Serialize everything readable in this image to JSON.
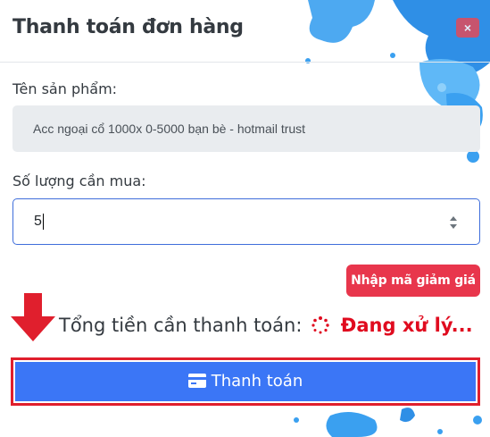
{
  "modal": {
    "title": "Thanh toán đơn hàng",
    "close_label": "×"
  },
  "product": {
    "label": "Tên sản phẩm:",
    "value": "Acc ngoại cổ 1000x 0-5000 bạn bè - hotmail trust"
  },
  "quantity": {
    "label": "Số lượng cần mua:",
    "value": "5"
  },
  "discount_button": "Nhập mã giảm giá",
  "total": {
    "label": "Tổng tiền cần thanh toán:",
    "status": "Đang xử lý..."
  },
  "pay_button": "Thanh toán",
  "colors": {
    "pay": "#3b76f6",
    "danger": "#e8364c",
    "highlight": "#e01f2d",
    "splash": "#3aa0f0"
  },
  "icons": [
    "close-icon",
    "stepper-icon",
    "spinner-icon",
    "down-arrow-icon",
    "credit-card-icon"
  ]
}
